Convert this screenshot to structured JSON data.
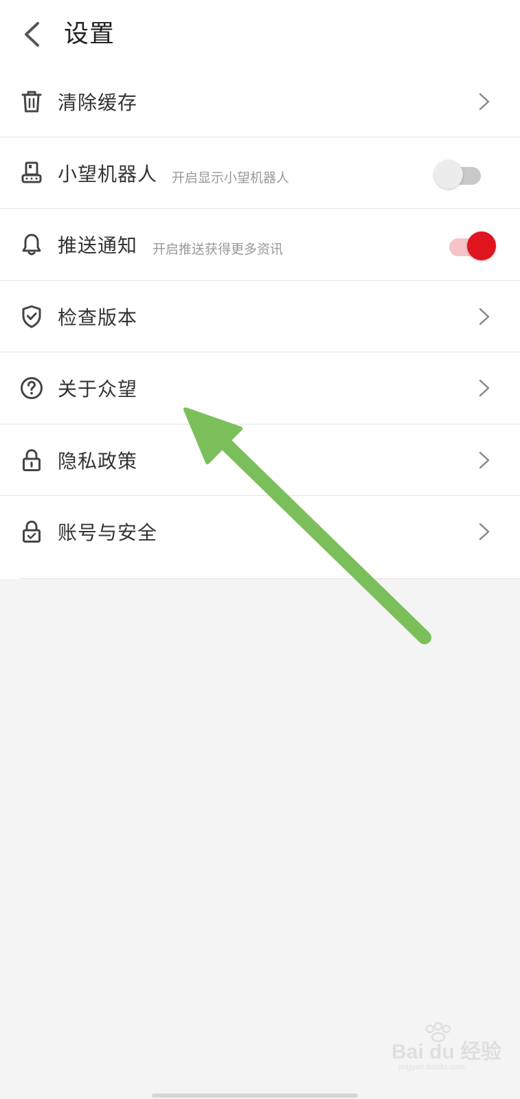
{
  "header": {
    "title": "设置",
    "back_icon": "chevron-left-icon"
  },
  "settings": {
    "clear_cache": {
      "label": "清除缓存",
      "icon": "trash-icon"
    },
    "robot": {
      "label": "小望机器人",
      "sublabel": "开启显示小望机器人",
      "icon": "robot-icon",
      "enabled": false
    },
    "push": {
      "label": "推送通知",
      "sublabel": "开启推送获得更多资讯",
      "icon": "bell-icon",
      "enabled": true
    },
    "check_version": {
      "label": "检查版本",
      "icon": "shield-check-icon"
    },
    "about": {
      "label": "关于众望",
      "icon": "question-circle-icon"
    },
    "privacy": {
      "label": "隐私政策",
      "icon": "lock-icon"
    },
    "account": {
      "label": "账号与安全",
      "icon": "lock-check-icon"
    }
  },
  "colors": {
    "accent": "#e0141e",
    "annotation_arrow": "#7bbf5a"
  },
  "watermark": {
    "brand": "Bai du 经验",
    "domain": "jingyan.baidu.com"
  }
}
